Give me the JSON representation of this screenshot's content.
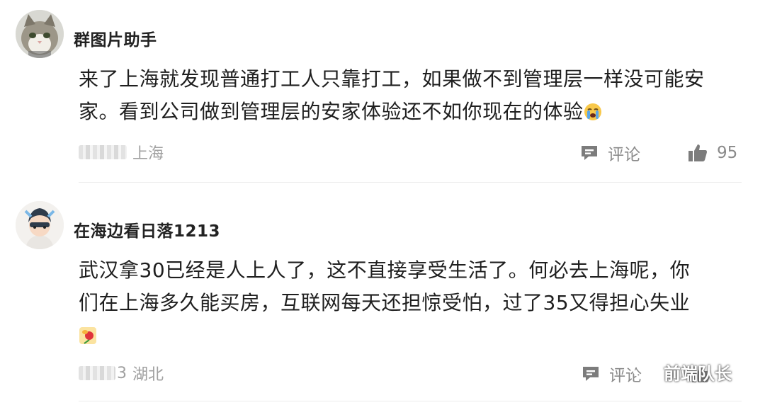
{
  "comments": [
    {
      "username": "群图片助手",
      "line1": "来了上海就发现普通打工人只靠打工，如果做不到管理层一样没可能安",
      "line2": "家。看到公司做到管理层的安家体验还不如你现在的体验",
      "emoji": "crying-face-emoji",
      "location": "上海",
      "reply_label": "评论",
      "like_count": "95"
    },
    {
      "username": "在海边看日落1213",
      "line1": "武汉拿30已经是人上人了，这不直接享受生活了。何必去上海呢，你",
      "line2": "们在上海多久能买房，互联网每天还担惊受怕，过了35又得担心失业",
      "emoji": "rose-emoji",
      "location_prefix": "3",
      "location": "湖北",
      "reply_label": "评论"
    }
  ],
  "watermark": {
    "text": "前端队长",
    "icon": "wechat-icon"
  },
  "colors": {
    "text": "#1f1f1f",
    "muted": "#a0a0a0",
    "icon": "#8a8a8a",
    "divider": "#ececec"
  }
}
